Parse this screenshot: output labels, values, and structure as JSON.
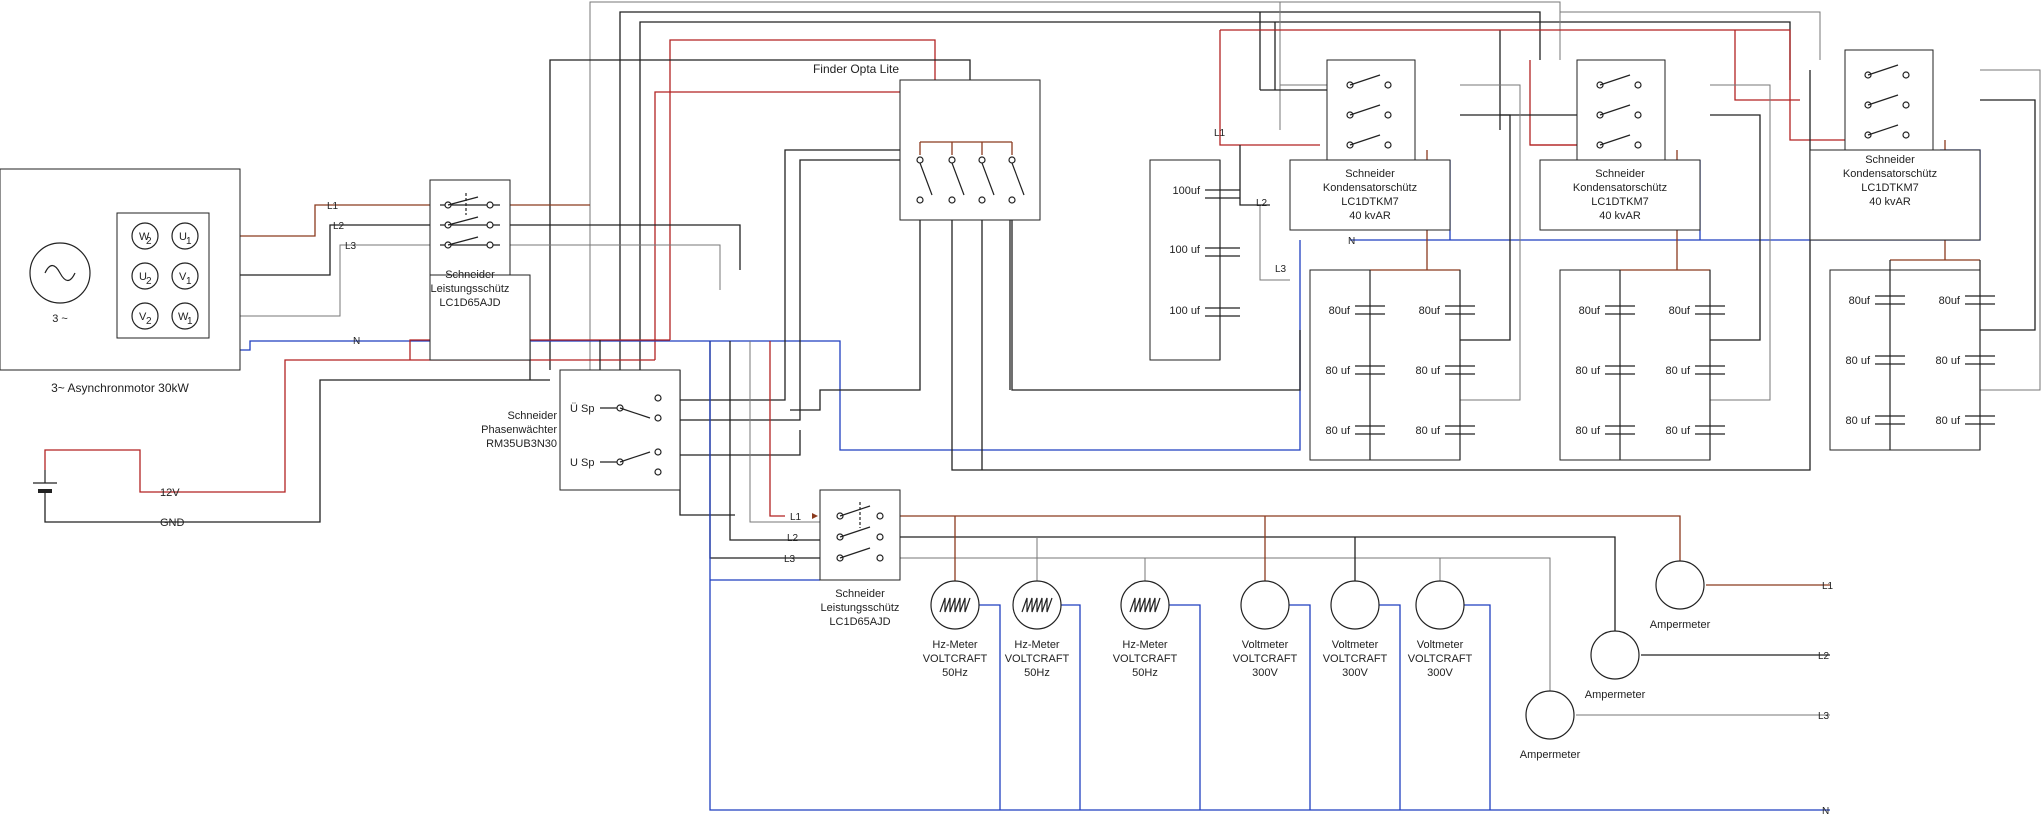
{
  "motor": {
    "label": "3~ Asynchronmotor 30kW",
    "source_label": "3 ~",
    "terminals": [
      {
        "letter": "W",
        "index": "2"
      },
      {
        "letter": "U",
        "index": "1"
      },
      {
        "letter": "U",
        "index": "2"
      },
      {
        "letter": "V",
        "index": "1"
      },
      {
        "letter": "V",
        "index": "2"
      },
      {
        "letter": "W",
        "index": "1"
      }
    ]
  },
  "phase_labels": {
    "l1": "L1",
    "l2": "L2",
    "l3": "L3",
    "n": "N"
  },
  "battery": {
    "plus_label": "12V",
    "gnd_label": "GND"
  },
  "main_contactor": {
    "line1": "Schneider",
    "line2": "Leistungsschütz",
    "line3": "LC1D65AJD"
  },
  "relay": {
    "label": "Finder Opta Lite"
  },
  "phase_monitor": {
    "line1": "Schneider",
    "line2": "Phasenwächter",
    "line3": "RM35UB3N30",
    "contact1": "Ü Sp",
    "contact2": "U Sp"
  },
  "meter_contactor": {
    "line1": "Schneider",
    "line2": "Leistungsschütz",
    "line3": "LC1D65AJD"
  },
  "capacitor_bank_1": {
    "values": [
      "100uf",
      "100 uf",
      "100 uf"
    ]
  },
  "cap_contactors": [
    {
      "line1": "Schneider",
      "line2": "Kondensatorschütz",
      "line3": "LC1DTKM7",
      "line4": "40 kvAR"
    },
    {
      "line1": "Schneider",
      "line2": "Kondensatorschütz",
      "line3": "LC1DTKM7",
      "line4": "40 kvAR"
    },
    {
      "line1": "Schneider",
      "line2": "Kondensatorschütz",
      "line3": "LC1DTKM7",
      "line4": "40 kvAR"
    }
  ],
  "cap_banks": [
    {
      "left": [
        "80uf",
        "80 uf",
        "80 uf"
      ],
      "right": [
        "80uf",
        "80 uf",
        "80 uf"
      ]
    },
    {
      "left": [
        "80uf",
        "80 uf",
        "80 uf"
      ],
      "right": [
        "80uf",
        "80 uf",
        "80 uf"
      ]
    },
    {
      "left": [
        "80uf",
        "80 uf",
        "80 uf"
      ],
      "right": [
        "80uf",
        "80 uf",
        "80 uf"
      ]
    }
  ],
  "meters": [
    {
      "line1": "Hz-Meter",
      "line2": "VOLTCRAFT",
      "line3": "50Hz"
    },
    {
      "line1": "Hz-Meter",
      "line2": "VOLTCRAFT",
      "line3": "50Hz"
    },
    {
      "line1": "Hz-Meter",
      "line2": "VOLTCRAFT",
      "line3": "50Hz"
    },
    {
      "line1": "Voltmeter",
      "line2": "VOLTCRAFT",
      "line3": "300V"
    },
    {
      "line1": "Voltmeter",
      "line2": "VOLTCRAFT",
      "line3": "300V"
    },
    {
      "line1": "Voltmeter",
      "line2": "VOLTCRAFT",
      "line3": "300V"
    }
  ],
  "ammeters": [
    {
      "label": "Ampermeter"
    },
    {
      "label": "Ampermeter"
    },
    {
      "label": "Ampermeter"
    }
  ],
  "outputs": {
    "l1": "L1",
    "l2": "L2",
    "l3": "L3",
    "n": "N"
  }
}
